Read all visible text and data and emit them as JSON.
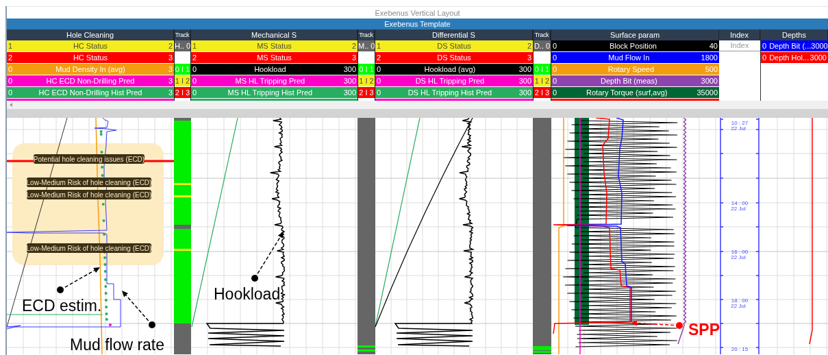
{
  "window": {
    "title": "Exebenus Vertical Layout"
  },
  "template": {
    "title": "Exebenus Template"
  },
  "panels": [
    {
      "kind": "curves",
      "title": "Hole Cleaning",
      "curves": [
        {
          "min": "1",
          "name": "HC Status",
          "max": "2",
          "color": "#f5ec1e"
        },
        {
          "min": "2",
          "name": "HC Status",
          "max": "3",
          "color": "#ff0000"
        },
        {
          "min": "0",
          "name": "Mud Density In (avg)",
          "max": "3",
          "color": "#f39c12"
        },
        {
          "min": "0",
          "name": "HC ECD Non-Drilling Pred",
          "max": "3",
          "color": "#ff00c8"
        },
        {
          "min": "0",
          "name": "HC ECD Non-Drilling Hist Pred",
          "max": "3",
          "color": "#27ae60"
        },
        {
          "color": "#ff00c8"
        }
      ]
    },
    {
      "kind": "track",
      "title": "Track",
      "cells": [
        {
          "label": "H..",
          "value": "0",
          "color": "#666666"
        },
        {
          "kind": "blank"
        },
        {
          "label": "0 I 1",
          "color": "#00ff00"
        },
        {
          "label": "1 I 2",
          "color": "#f5ec1e"
        },
        {
          "label": "2 I 3",
          "color": "#ff0000"
        }
      ]
    },
    {
      "kind": "curves",
      "title": "Mechanical S",
      "curves": [
        {
          "min": "1",
          "name": "MS Status",
          "max": "2",
          "color": "#f5ec1e"
        },
        {
          "min": "2",
          "name": "MS Status",
          "max": "3",
          "color": "#ff0000"
        },
        {
          "min": "0",
          "name": "Hookload",
          "max": "300",
          "color": "#000000"
        },
        {
          "min": "0",
          "name": "MS HL Tripping Pred",
          "max": "300",
          "color": "#ff00c8"
        },
        {
          "min": "0",
          "name": "MS HL Tripping Hist Pred",
          "max": "300",
          "color": "#27ae60"
        },
        {
          "color": "#27ae60"
        }
      ]
    },
    {
      "kind": "track",
      "title": "Track",
      "cells": [
        {
          "label": "M..",
          "value": "0",
          "color": "#666666"
        },
        {
          "kind": "blank"
        },
        {
          "label": "0 I 1",
          "color": "#00ff00"
        },
        {
          "label": "1 I 2",
          "color": "#f5ec1e"
        },
        {
          "label": "2 I 3",
          "color": "#ff0000"
        }
      ]
    },
    {
      "kind": "curves",
      "title": "Differential S",
      "curves": [
        {
          "min": "1",
          "name": "DS Status",
          "max": "2",
          "color": "#f5ec1e"
        },
        {
          "min": "2",
          "name": "DS Status",
          "max": "3",
          "color": "#ff0000"
        },
        {
          "min": "0",
          "name": "Hookload (avg)",
          "max": "300",
          "color": "#000000"
        },
        {
          "min": "0",
          "name": "DS HL Tripping Pred",
          "max": "300",
          "color": "#ff00c8"
        },
        {
          "min": "0",
          "name": "DS HL Tripping Hist Pred",
          "max": "300",
          "color": "#27ae60"
        },
        {
          "color": "#ff00c8"
        }
      ]
    },
    {
      "kind": "track",
      "title": "Track",
      "cells": [
        {
          "label": "D..",
          "value": "0",
          "color": "#666666"
        },
        {
          "kind": "blank"
        },
        {
          "label": "0 I 1",
          "color": "#00ff00"
        },
        {
          "label": "1 I 2",
          "color": "#f5ec1e"
        },
        {
          "label": "2 I 3",
          "color": "#ff0000"
        }
      ]
    },
    {
      "kind": "curves",
      "title": "Surface param",
      "curves": [
        {
          "min": "0",
          "name": "Block Position",
          "max": "40",
          "color": "#000000"
        },
        {
          "min": "0",
          "name": "Mud Flow In",
          "max": "1800",
          "color": "#0000ff"
        },
        {
          "min": "0",
          "name": "Rotary Speed",
          "max": "500",
          "color": "#f39c12"
        },
        {
          "min": "0",
          "name": "Depth Bit (meas)",
          "max": "3000",
          "color": "#8e44ad"
        },
        {
          "min": "0",
          "name": "Rotary Torque (surf,avg)",
          "max": "35000",
          "color": "#006633"
        },
        {
          "color": "#ff0000"
        }
      ]
    },
    {
      "kind": "index",
      "title": "Index",
      "placeholder": "Index"
    },
    {
      "kind": "depths",
      "title": "Depths",
      "curves": [
        {
          "min": "0",
          "name": "Depth Bit (...",
          "max": "3000",
          "color": "#0000ff"
        },
        {
          "min": "0",
          "name": "Depth Hol...",
          "max": "3000",
          "color": "#ff0000"
        }
      ]
    }
  ],
  "plot": {
    "annotations": [
      "Potential hole cleaning issues (ECD)",
      "Low-Medium Risk of hole cleaning (ECD)",
      "Low-Medium Risk of hole cleaning (ECD)",
      "Low-Medium Risk of hole cleaning (ECD)"
    ],
    "callouts": [
      {
        "text": "ECD estim.",
        "color": "#000000"
      },
      {
        "text": "Mud flow rate",
        "color": "#000000"
      },
      {
        "text": "Hookload",
        "color": "#000000"
      },
      {
        "text": "SPP",
        "color": "#ff0000"
      }
    ],
    "time_axis": [
      {
        "time": "10 : 27",
        "date": "22 Jul"
      },
      {
        "time": "14 : 00",
        "date": "22 Jul"
      },
      {
        "time": "16 : 00",
        "date": "22 Jul"
      },
      {
        "time": "18 : 00",
        "date": "22 Jul"
      },
      {
        "time": "20 : 15"
      }
    ]
  }
}
